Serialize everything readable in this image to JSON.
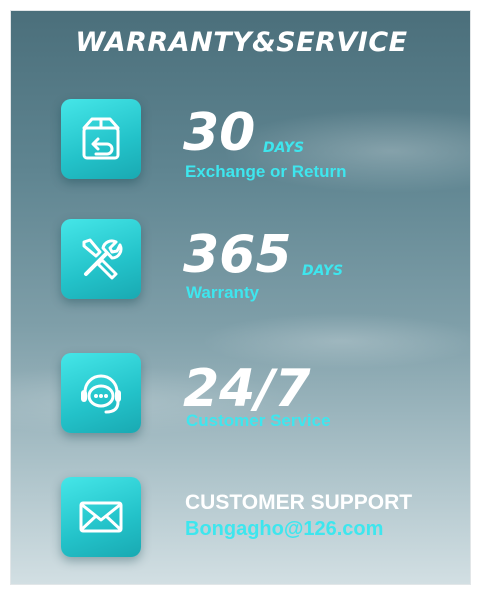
{
  "title": "WARRANTY&SERVICE",
  "items": [
    {
      "icon": "return-box-icon",
      "big": "30",
      "unit": "DAYS",
      "label": "Exchange or Return"
    },
    {
      "icon": "tools-icon",
      "big": "365",
      "unit": "DAYS",
      "label": "Warranty"
    },
    {
      "icon": "chat-support-icon",
      "big": "24/7",
      "label": "Customer Service"
    },
    {
      "icon": "envelope-icon",
      "big": "CUSTOMER SUPPORT",
      "label": "Bongagho@126.com"
    }
  ],
  "colors": {
    "accent": "#3ee6ee",
    "icon_bg": "#23c2c9",
    "text": "#ffffff"
  }
}
